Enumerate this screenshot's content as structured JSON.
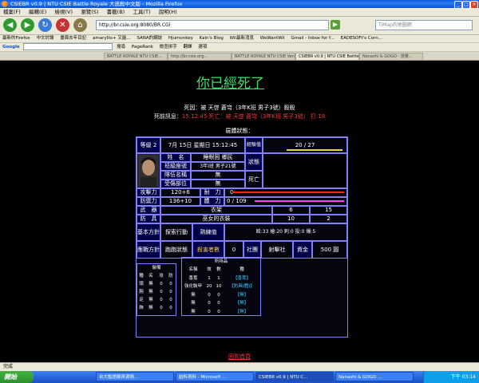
{
  "window": {
    "title": "CSIEBR v0.9 | NTU CSIE Battle Royale 大逃殺中文版 - Mozilla Firefox"
  },
  "menu": [
    "檔案(F)",
    "編輯(E)",
    "檢視(V)",
    "瀏覽(S)",
    "書籤(B)",
    "工具(T)",
    "說明(H)"
  ],
  "nav": {
    "url": "http://br.csie.org:8080/BR.CGI",
    "search_placeholder": "TiMap的地圖網"
  },
  "bookmarks": [
    "最新的Firefox",
    "中文討論",
    "畫面去年目記",
    "amaryllis+ 又能...",
    "SANA的網誌",
    "Hjumonkey",
    "Kain's Blog",
    "Wii最新消息",
    "WeWantWii",
    "Gmail - Inbox for f...",
    "EADESOFt's Corn..."
  ],
  "google_bar": {
    "label": "Google",
    "items": [
      "搜尋",
      "PageRank",
      "檢查拼字",
      "翻譯",
      "選項"
    ]
  },
  "tabs": [
    "BATTLE ROYALE NTU CSIE...",
    "http://br.csie.org...",
    "BATTLE ROYALE NTU CSIE Version",
    "CSIEBR v0.9 | NTU CSIE Battle Royal...",
    "Nanashi & GOGO - 感覺..."
  ],
  "content": {
    "title": "你已經死了",
    "cause": "死因：被 天啓 蒼穹（3年K班 男子3號）殺殺",
    "last_words_prefix": "死前訊息：",
    "last_words": "15:12:45 死亡：被 天啓 蒼穹（3年K班 男子3號） 打:18",
    "status_title": "屍體狀態：",
    "level": "等級 2",
    "date": "7月 15日 星期日 15:12:45",
    "exp_label": "經驗值",
    "exp_value": "20 / 27",
    "name_label": "姓　名",
    "name_value": "睡眼困 鄉民",
    "class_label": "班級座號",
    "class_value": "3年I班 男子21號",
    "team_label": "隊伍名稱",
    "team_value": "無",
    "injury_label": "受傷部位",
    "injury_value": "無",
    "status_label": "狀態",
    "status_value": "死亡",
    "atk_label": "攻擊力",
    "atk_value": "120+6",
    "hp_label": "耐　力",
    "hp_value": "0",
    "def_label": "防禦力",
    "def_value": "136+10",
    "stamina_label": "體　力",
    "stamina_value": "0 / 109",
    "weapon_label": "武　器",
    "weapon_value": "衣架",
    "weapon_a": "6",
    "weapon_b": "15",
    "armor_label": "防　具",
    "armor_value": "巫女的衣裝",
    "armor_a": "10",
    "armor_b": "2",
    "basic_label": "基本方針",
    "basic_value": "探索行動",
    "skill_label": "熟練值",
    "skill_value": "殴:33 槍:20 刺:0 投:0 爆:5",
    "response_label": "應戰方針",
    "response_value": "跑跑狀態",
    "kills_label": "殺害者數",
    "kills_value": "0",
    "group_label": "社團",
    "group_value": "射擊社",
    "money_label": "資金",
    "money_value": "500 圓",
    "equip_title": "裝備",
    "equip_headers": [
      "種",
      "名",
      "攻",
      "防"
    ],
    "equip_rows": [
      [
        "頭",
        "無",
        "0",
        "0"
      ],
      [
        "腕",
        "無",
        "0",
        "0"
      ],
      [
        "足",
        "無",
        "0",
        "0"
      ],
      [
        "飾",
        "無",
        "0",
        "0"
      ]
    ],
    "items_title": "所持品",
    "items_headers": [
      "名稱",
      "效",
      "數",
      "種"
    ],
    "items_rows": [
      [
        "香蕉",
        "1",
        "1",
        "【香蕉】"
      ],
      [
        "強化裝甲",
        "20",
        "10",
        "【防具(體)】"
      ],
      [
        "無",
        "0",
        "0",
        "【無】"
      ],
      [
        "無",
        "0",
        "0",
        "【無】"
      ],
      [
        "無",
        "0",
        "0",
        "【無】"
      ]
    ],
    "back_link": "回到首頁"
  },
  "statusbar": {
    "text": "完成"
  },
  "taskbar": {
    "start": "開始",
    "buttons": [
      "台大點語錄資源情...",
      "結料資料 - Microsoft ...",
      "CSIEBR v0.9 | NTU C...",
      "Nanashi & GOGO ..."
    ],
    "clock": "下午 03:14"
  },
  "colors": {
    "title_green": "#31e36b",
    "border_blue": "#8080ff",
    "red": "#ff3333"
  }
}
